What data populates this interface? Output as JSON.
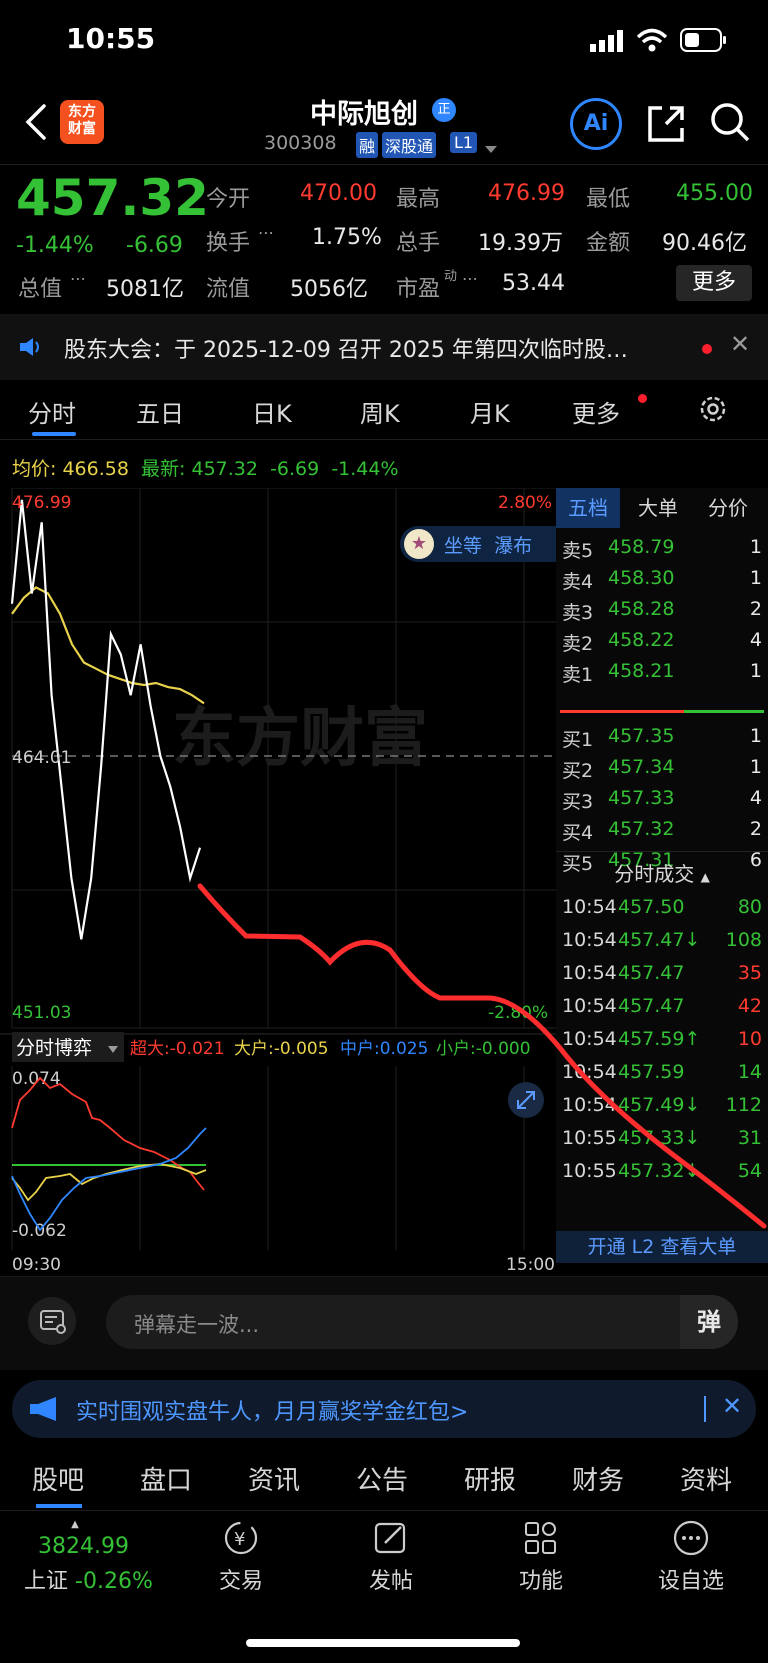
{
  "status_bar": {
    "time": "10:55"
  },
  "header": {
    "logo_text": "东方\n财富",
    "stock_name": "中际旭创",
    "stock_code": "300308",
    "tags": [
      "融",
      "深股通",
      "L1"
    ],
    "name_badge": "正",
    "ai_label": "Ai"
  },
  "quote": {
    "price": "457.32",
    "change_pct": "-1.44%",
    "change": "-6.69",
    "open_label": "今开",
    "open": "470.00",
    "high_label": "最高",
    "high": "476.99",
    "low_label": "最低",
    "low": "455.00",
    "turnover_label": "换手",
    "turnover": "1.75%",
    "volume_label": "总手",
    "volume": "19.39万",
    "amount_label": "金额",
    "amount": "90.46亿",
    "mktcap_label": "总值",
    "mktcap": "5081亿",
    "float_label": "流值",
    "float": "5056亿",
    "pe_label": "市盈",
    "pe_sup": "动",
    "pe": "53.44",
    "more_label": "更多"
  },
  "notice": {
    "text": "股东大会：于 2025-12-09 召开 2025 年第四次临时股…"
  },
  "tabs": {
    "items": [
      "分时",
      "五日",
      "日K",
      "周K",
      "月K",
      "更多"
    ]
  },
  "avg_line": {
    "avg_label": "均价:",
    "avg": "466.58",
    "latest_label": "最新:",
    "latest": "457.32",
    "change": "-6.69",
    "change_pct": "-1.44%"
  },
  "chart_data": {
    "type": "line",
    "y_top": "476.99",
    "y_mid": "464.01",
    "y_bottom": "451.03",
    "pct_top": "2.80%",
    "pct_bottom": "-2.80%",
    "ylim": [
      451.03,
      476.99
    ],
    "x_start": "09:30",
    "x_end": "15:00",
    "watermark": "东方财富",
    "popup_text": "坐等  瀑布",
    "series": [
      {
        "name": "price",
        "values": [
          471.5,
          476.6,
          472.0,
          475.5,
          467.0,
          462.5,
          458.0,
          455.0,
          458.0,
          463.5,
          470.0,
          469.0,
          467.0,
          469.5,
          466.5,
          464.0,
          462.5,
          460.5,
          458.0,
          459.5
        ]
      },
      {
        "name": "avg",
        "values": [
          471.0,
          471.8,
          472.3,
          472.0,
          471.0,
          469.5,
          468.6,
          468.3,
          468.0,
          467.8,
          467.6,
          467.5,
          467.6,
          467.4,
          467.3,
          467.0,
          466.6
        ]
      }
    ],
    "sub_title": "分时博弈",
    "sub_legend": [
      {
        "label": "超大:-0.021",
        "color": "#ff3b30"
      },
      {
        "label": "大户:-0.005",
        "color": "#e8d24b"
      },
      {
        "label": "中户:0.025",
        "color": "#2f86ff"
      },
      {
        "label": "小户:-0.000",
        "color": "#35c136"
      }
    ],
    "sub_top": "0.074",
    "sub_bottom": "-0.062"
  },
  "book": {
    "tabs": [
      "五档",
      "大单",
      "分价"
    ],
    "asks": [
      {
        "label": "卖5",
        "price": "458.79",
        "qty": "1"
      },
      {
        "label": "卖4",
        "price": "458.30",
        "qty": "1"
      },
      {
        "label": "卖3",
        "price": "458.28",
        "qty": "2"
      },
      {
        "label": "卖2",
        "price": "458.22",
        "qty": "4"
      },
      {
        "label": "卖1",
        "price": "458.21",
        "qty": "1"
      }
    ],
    "bids": [
      {
        "label": "买1",
        "price": "457.35",
        "qty": "1"
      },
      {
        "label": "买2",
        "price": "457.34",
        "qty": "1"
      },
      {
        "label": "买3",
        "price": "457.33",
        "qty": "4"
      },
      {
        "label": "买4",
        "price": "457.32",
        "qty": "2"
      },
      {
        "label": "买5",
        "price": "457.31",
        "qty": "6"
      }
    ],
    "ticks_title": "分时成交",
    "ticks": [
      {
        "time": "10:54",
        "price": "457.50",
        "qty": "80",
        "qty_color": "green"
      },
      {
        "time": "10:54",
        "price": "457.47↓",
        "qty": "108",
        "qty_color": "green"
      },
      {
        "time": "10:54",
        "price": "457.47",
        "qty": "35",
        "qty_color": "red"
      },
      {
        "time": "10:54",
        "price": "457.47",
        "qty": "42",
        "qty_color": "red"
      },
      {
        "time": "10:54",
        "price": "457.59↑",
        "qty": "10",
        "qty_color": "red"
      },
      {
        "time": "10:54",
        "price": "457.59",
        "qty": "14",
        "qty_color": "green"
      },
      {
        "time": "10:54",
        "price": "457.49↓",
        "qty": "112",
        "qty_color": "green"
      },
      {
        "time": "10:55",
        "price": "457.33↓",
        "qty": "31",
        "qty_color": "green"
      },
      {
        "time": "10:55",
        "price": "457.32↓",
        "qty": "54",
        "qty_color": "green"
      }
    ],
    "l2_link": "开通 L2 查看大单"
  },
  "chat": {
    "placeholder": "弹幕走一波...",
    "send_icon": "弹"
  },
  "promo": {
    "text": "实时围观实盘牛人，月月赢奖学金红包>"
  },
  "bottom_tabs": [
    "股吧",
    "盘口",
    "资讯",
    "公告",
    "研报",
    "财务",
    "资料"
  ],
  "dock": {
    "index_value": "3824.99",
    "index_name": "上证",
    "index_change": "-0.26%",
    "items": [
      "交易",
      "发帖",
      "功能",
      "设自选"
    ]
  }
}
